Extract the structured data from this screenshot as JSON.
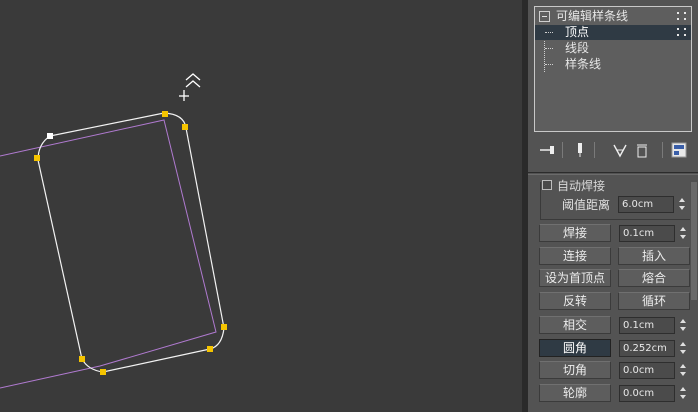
{
  "colors": {
    "viewport_bg": "#3a3a3a",
    "spline_selected": "#f2f2f2",
    "spline_other": "#b07ad0",
    "vertex": "#f5c400",
    "first_vertex": "#ffffff",
    "selection_blue": "#2f3a44"
  },
  "viewport": {
    "cursor_icon": "move-cursor-icon"
  },
  "modifier_stack": {
    "items": [
      {
        "label": "可编辑样条线",
        "level": 0,
        "selected": false
      },
      {
        "label": "顶点",
        "level": 1,
        "selected": true
      },
      {
        "label": "线段",
        "level": 1,
        "selected": false
      },
      {
        "label": "样条线",
        "level": 1,
        "selected": false
      }
    ]
  },
  "stack_toolbar": {
    "icons": [
      "pin-stack-icon",
      "show-end-result-icon",
      "make-unique-icon",
      "remove-modifier-icon",
      "configure-modifier-sets-icon"
    ]
  },
  "geometry": {
    "auto_weld_label": "自动焊接",
    "threshold_label": "阈值距离",
    "threshold_value": "6.0cm",
    "weld_label": "焊接",
    "weld_value": "0.1cm",
    "connect_label": "连接",
    "insert_label": "插入",
    "make_first_label": "设为首顶点",
    "fuse_label": "熔合",
    "reverse_label": "反转",
    "cycle_label": "循环",
    "cross_insert_label": "相交",
    "cross_insert_value": "0.1cm",
    "fillet_label": "圆角",
    "fillet_value": "0.252cm",
    "chamfer_label": "切角",
    "chamfer_value": "0.0cm",
    "outline_label": "轮廓",
    "outline_value": "0.0cm"
  }
}
